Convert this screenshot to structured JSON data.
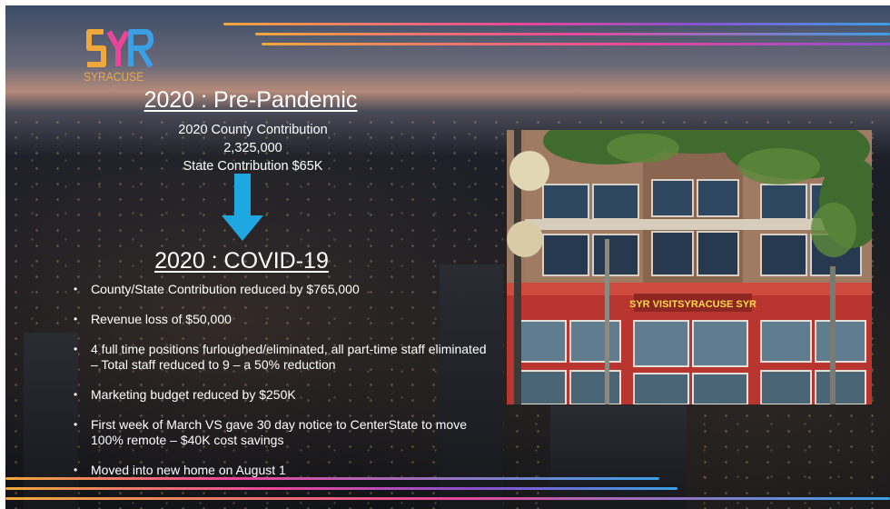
{
  "logo": {
    "glyph_letters": "SYR",
    "wordmark": "SYRACUSE",
    "colors": [
      "#f0a83c",
      "#e8469a",
      "#3aa0e6",
      "#8b4fd0"
    ]
  },
  "pre_pandemic": {
    "heading": "2020 : Pre-Pandemic",
    "lines": [
      "2020 County Contribution",
      "2,325,000",
      "State Contribution $65K"
    ]
  },
  "covid": {
    "heading": "2020 : COVID-19",
    "bullets": [
      "County/State Contribution reduced by $765,000",
      "Revenue loss of $50,000",
      "4 full time positions furloughed/eliminated, all part-time staff eliminated – Total staff reduced to 9 – a 50% reduction",
      "Marketing budget reduced by $250K",
      "First week of March VS gave 30 day notice to CenterState to move 100% remote – $40K cost savings",
      "Moved into new home on August 1"
    ]
  },
  "photo": {
    "sign_text": "SYR VISITSYRACUSE SYR",
    "subject": "building-facade-photo"
  },
  "colors": {
    "arrow": "#1ea7e0",
    "stripe_orange": "#f0a83c",
    "stripe_pink": "#e8469a",
    "stripe_blue": "#3aa0e6"
  }
}
